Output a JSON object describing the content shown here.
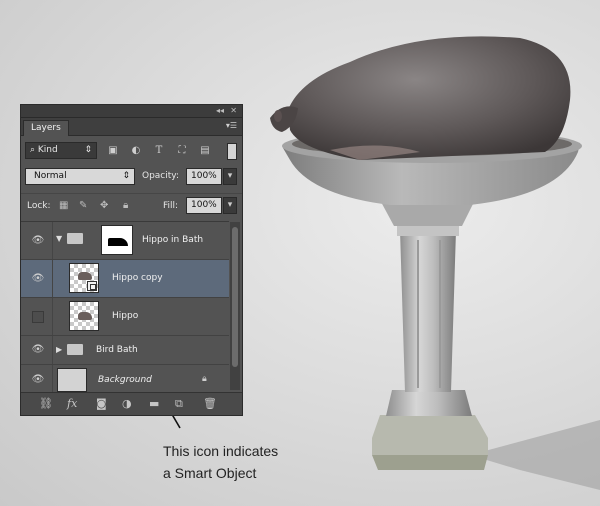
{
  "panel": {
    "tab_label": "Layers",
    "menu_icon": "panel-menu-icon",
    "filter": {
      "label": "Kind",
      "icons": [
        "image-filter-icon",
        "adjustment-filter-icon",
        "type-filter-icon",
        "shape-filter-icon",
        "smart-object-filter-icon"
      ]
    },
    "blend_mode": "Normal",
    "opacity_label": "Opacity:",
    "opacity_value": "100%",
    "lock_label": "Lock:",
    "fill_label": "Fill:",
    "fill_value": "100%",
    "layers": [
      {
        "name": "Hippo in Bath",
        "type": "group",
        "expanded": true,
        "visible": true
      },
      {
        "name": "Hippo copy",
        "type": "smart-object",
        "visible": true,
        "selected": true
      },
      {
        "name": "Hippo",
        "type": "layer",
        "visible": false
      },
      {
        "name": "Bird Bath",
        "type": "group",
        "expanded": false,
        "visible": true
      },
      {
        "name": "Background",
        "type": "background",
        "visible": true,
        "locked": true
      }
    ],
    "footer_icons": [
      "link-layers-icon",
      "fx-icon",
      "mask-icon",
      "adjustment-icon",
      "new-group-icon",
      "new-layer-icon",
      "trash-icon"
    ]
  },
  "annotation": {
    "line1": "This icon indicates",
    "line2": "a Smart Object"
  },
  "colors": {
    "selected_row": "#5d6a7b",
    "panel_bg": "#535353"
  }
}
